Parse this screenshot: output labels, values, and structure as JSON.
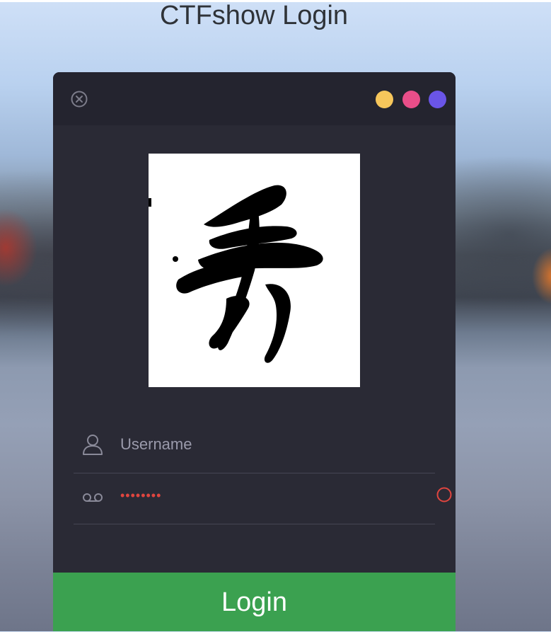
{
  "page": {
    "title": "CTFshow Login"
  },
  "window": {
    "close_icon": "close-circle-icon",
    "dots": [
      {
        "name": "yellow-dot",
        "color": "#f6c65b"
      },
      {
        "name": "pink-dot",
        "color": "#e94e89"
      },
      {
        "name": "purple-dot",
        "color": "#6a55e8"
      }
    ]
  },
  "captcha": {
    "icon": "calligraphy-captcha-image"
  },
  "form": {
    "username": {
      "icon": "user-icon",
      "placeholder": "Username",
      "value": ""
    },
    "password": {
      "icon": "voicemail-icon",
      "placeholder": "",
      "value": "••••••••"
    },
    "warning_icon": "warning-circle-icon",
    "login_label": "Login"
  },
  "colors": {
    "panel": "#2a2a35",
    "header": "#24242f",
    "button": "#3ba150",
    "password_text": "#e0453f"
  }
}
